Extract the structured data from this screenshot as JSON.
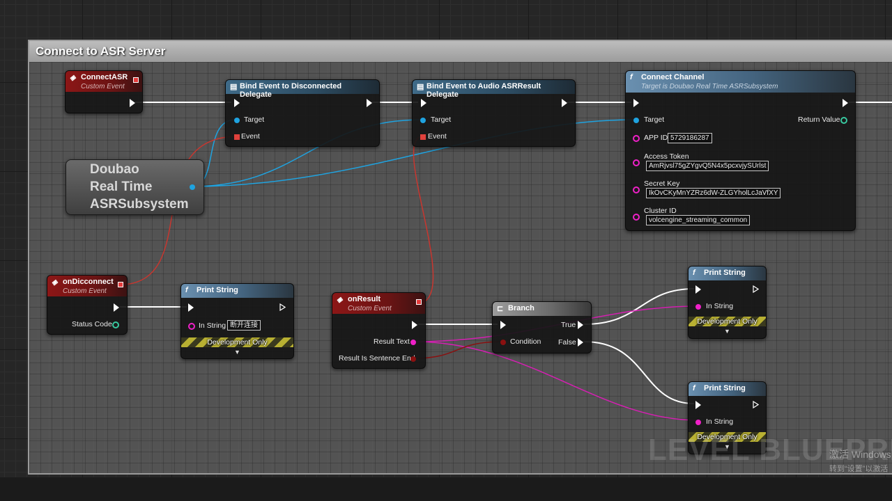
{
  "comment": {
    "title": "Connect to ASR Server"
  },
  "nodes": {
    "connect_asr": {
      "title": "ConnectASR",
      "subtitle": "Custom Event"
    },
    "bind_disconnected": {
      "title": "Bind Event to Disconnected Delegate",
      "pin_target": "Target",
      "pin_event": "Event"
    },
    "bind_audio": {
      "title": "Bind Event to Audio ASRResult Delegate",
      "pin_target": "Target",
      "pin_event": "Event"
    },
    "connect_channel": {
      "title": "Connect Channel",
      "subtitle": "Target is Doubao Real Time ASRSubsystem",
      "pin_target": "Target",
      "pin_return": "Return Value",
      "app_id_label": "APP ID",
      "app_id_value": "5729186287",
      "access_token_label": "Access Token",
      "access_token_value": "AmRjvsl75gZYgvQ5N4x5pcxvjySUrlst",
      "secret_key_label": "Secret Key",
      "secret_key_value": "IkOvCKyMnYZRz6dW-ZLGYholLcJaVfXY",
      "cluster_id_label": "Cluster ID",
      "cluster_id_value": "volcengine_streaming_common"
    },
    "doubao_var": {
      "line1": "Doubao",
      "line2": "Real Time",
      "line3": "ASRSubsystem"
    },
    "on_disconnect": {
      "title": "onDicconnect",
      "subtitle": "Custom Event",
      "pin_status": "Status Code"
    },
    "print_string_1": {
      "title": "Print String",
      "pin_in": "In String",
      "in_value": "断开连接",
      "dev_only": "Development Only"
    },
    "on_result": {
      "title": "onResult",
      "subtitle": "Custom Event",
      "pin_result_text": "Result Text",
      "pin_sentence_end": "Result Is Sentence End"
    },
    "branch": {
      "title": "Branch",
      "pin_condition": "Condition",
      "pin_true": "True",
      "pin_false": "False"
    },
    "print_string_2": {
      "title": "Print String",
      "pin_in": "In String",
      "dev_only": "Development Only"
    },
    "print_string_3": {
      "title": "Print String",
      "pin_in": "In String",
      "dev_only": "Development Only"
    }
  },
  "watermark": "LEVEL BLUEPRINT",
  "windows_activation": {
    "line1": "激活 Windows",
    "line2": "转到“设置”以激活"
  },
  "colors": {
    "exec": "#ffffff",
    "object": "#1fa3e0",
    "delegate": "#e0413c",
    "string": "#f020c8",
    "bool": "#8a1010",
    "struct": "#38c9a0"
  }
}
